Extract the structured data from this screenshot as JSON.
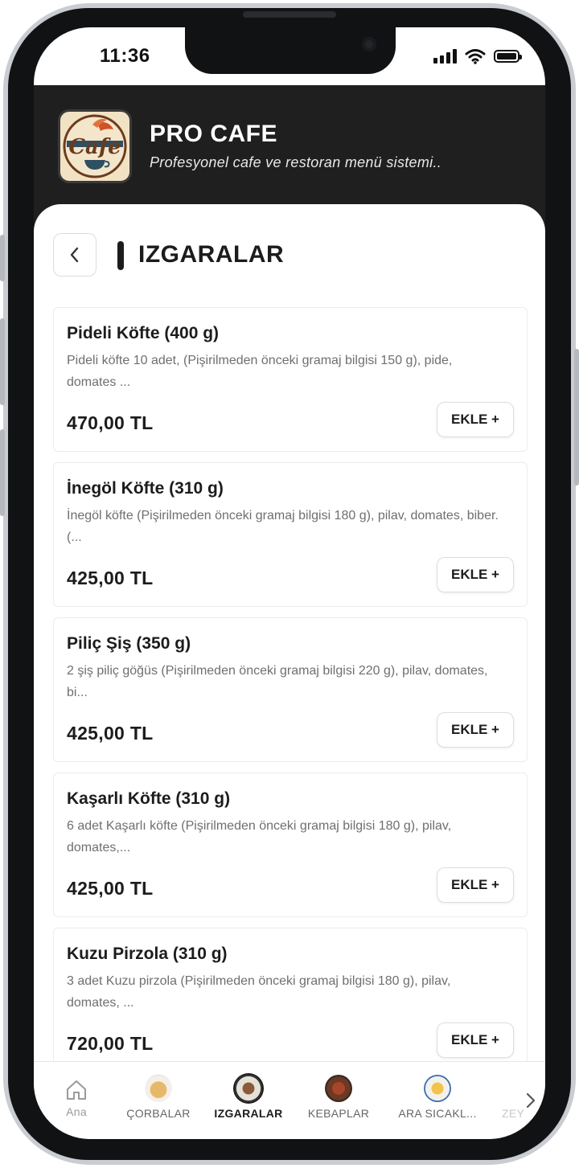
{
  "status_bar": {
    "time": "11:36"
  },
  "header": {
    "logo_text": "Cafe",
    "title": "PRO CAFE",
    "subtitle": "Profesyonel cafe ve restoran menü sistemi.."
  },
  "page": {
    "title": "IZGARALAR"
  },
  "items": [
    {
      "name": "Pideli Köfte (400 g)",
      "desc": "Pideli köfte 10 adet, (Pişirilmeden önceki gramaj bilgisi 150 g), pide, domates ...",
      "price": "470,00 TL",
      "button": "EKLE +"
    },
    {
      "name": "İnegöl Köfte (310 g)",
      "desc": "İnegöl köfte (Pişirilmeden önceki gramaj bilgisi 180 g), pilav, domates, biber.(...",
      "price": "425,00 TL",
      "button": "EKLE +"
    },
    {
      "name": "Piliç Şiş (350 g)",
      "desc": "2 şiş piliç göğüs (Pişirilmeden önceki gramaj bilgisi 220 g), pilav, domates, bi...",
      "price": "425,00 TL",
      "button": "EKLE +"
    },
    {
      "name": "Kaşarlı Köfte (310 g)",
      "desc": "6 adet Kaşarlı köfte (Pişirilmeden önceki gramaj bilgisi 180 g), pilav, domates,...",
      "price": "425,00 TL",
      "button": "EKLE +"
    },
    {
      "name": "Kuzu Pirzola (310 g)",
      "desc": "3 adet Kuzu pirzola (Pişirilmeden önceki gramaj bilgisi 180 g), pilav, domates, ...",
      "price": "720,00 TL",
      "button": "EKLE +"
    }
  ],
  "nav": {
    "items": [
      {
        "label": "Ana",
        "icon": "home-icon"
      },
      {
        "label": "ÇORBALAR",
        "icon": "soup-thumbnail"
      },
      {
        "label": "IZGARALAR",
        "icon": "grill-thumbnail",
        "active": true
      },
      {
        "label": "KEBAPLAR",
        "icon": "kebab-thumbnail"
      },
      {
        "label": "ARA SICAKL...",
        "icon": "starter-thumbnail"
      },
      {
        "label": "ZEY",
        "icon": "olive-oil-dish-thumbnail"
      }
    ],
    "more_icon": "chevron-right-icon"
  },
  "colors": {
    "header_bg": "#1f1f1f",
    "text_dark": "#1c1c1c",
    "text_muted": "#6f6f6f"
  }
}
